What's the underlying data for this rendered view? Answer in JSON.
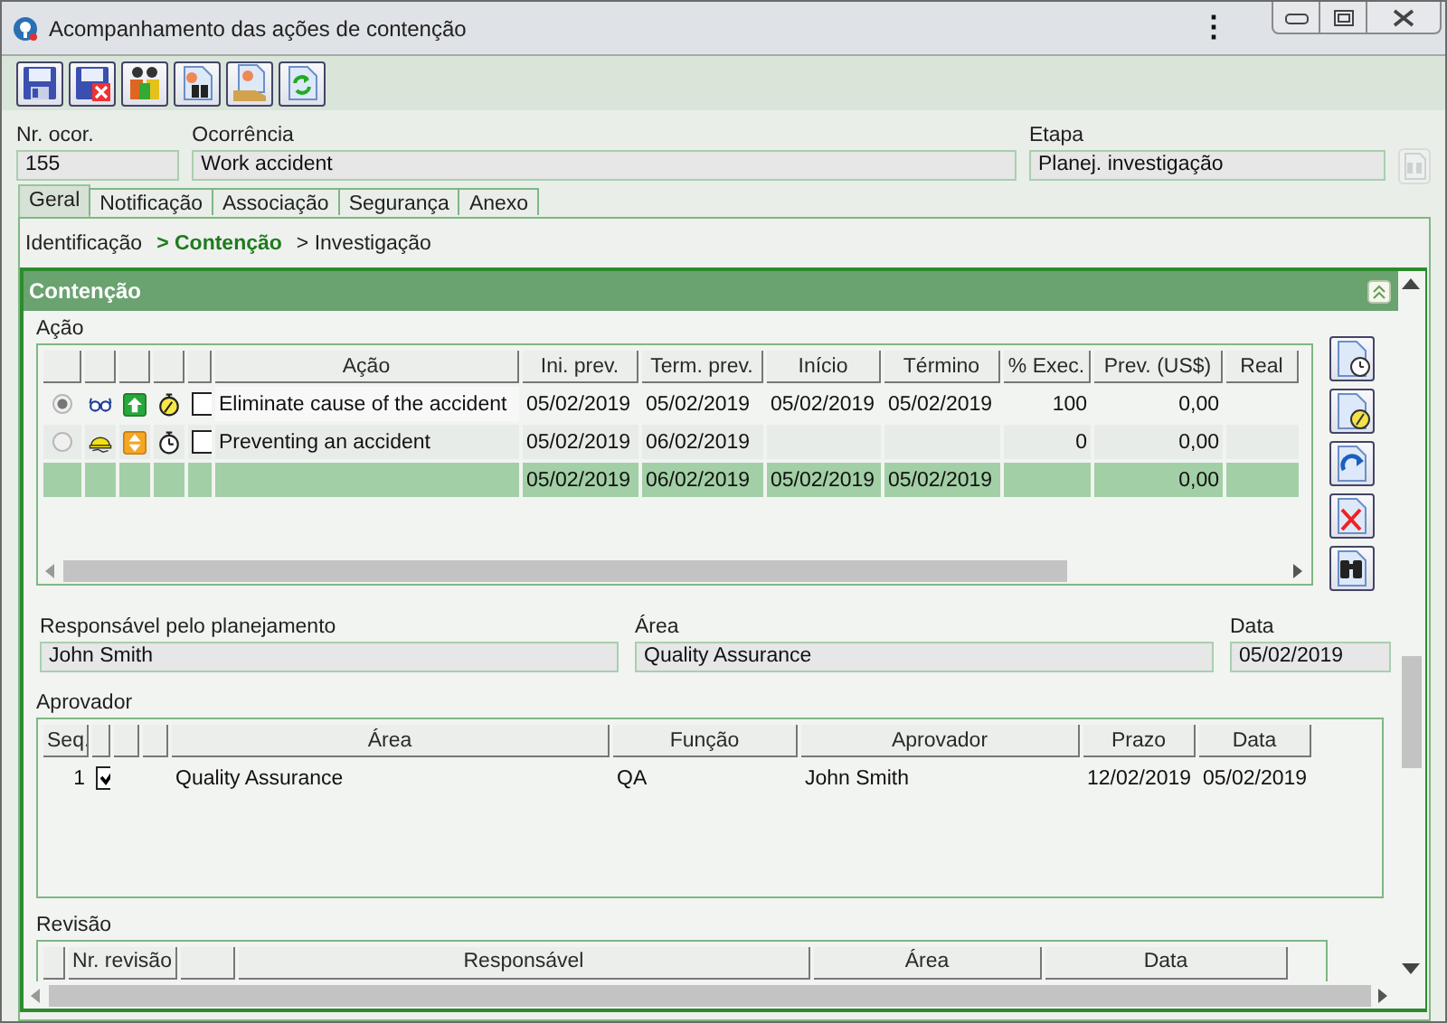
{
  "window": {
    "title": "Acompanhamento das ações de contenção",
    "menu_glyph": "⋮"
  },
  "header_fields": {
    "occurrence_number": {
      "label": "Nr. ocor.",
      "value": "155"
    },
    "occurrence": {
      "label": "Ocorrência",
      "value": "Work accident"
    },
    "stage": {
      "label": "Etapa",
      "value": "Planej. investigação",
      "lookup_disabled": true
    }
  },
  "tabs": [
    {
      "label": "Geral",
      "selected": true
    },
    {
      "label": "Notificação",
      "selected": false
    },
    {
      "label": "Associação",
      "selected": false
    },
    {
      "label": "Segurança",
      "selected": false
    },
    {
      "label": "Anexo",
      "selected": false
    }
  ],
  "steps": [
    {
      "label": "Identificação",
      "selected": false
    },
    {
      "label": "> Contenção",
      "selected": true
    },
    {
      "label": "> Investigação",
      "selected": false
    }
  ],
  "section": {
    "title": "Contenção",
    "expanded": true
  },
  "actions": {
    "label": "Ação",
    "columns": [
      {
        "kind": "radio"
      },
      {
        "kind": "category"
      },
      {
        "kind": "priority"
      },
      {
        "kind": "timer"
      },
      {
        "kind": "check"
      },
      {
        "kind": "text",
        "label": "Ação"
      },
      {
        "kind": "text",
        "label": "Ini. prev."
      },
      {
        "kind": "text",
        "label": "Term. prev."
      },
      {
        "kind": "text",
        "label": "Início"
      },
      {
        "kind": "text",
        "label": "Término"
      },
      {
        "kind": "text",
        "label": "% Exec."
      },
      {
        "kind": "text",
        "label": "Prev. (US$)"
      },
      {
        "kind": "text",
        "label": "Real"
      }
    ],
    "rows": [
      {
        "selected": true,
        "safety_category": false,
        "high_priority": true,
        "timer_alert": true,
        "checked": false,
        "cells": [
          "",
          "",
          "",
          "",
          "",
          "Eliminate cause of the accident",
          "05/02/2019",
          "05/02/2019",
          "05/02/2019",
          "05/02/2019",
          "100",
          "0,00",
          ""
        ]
      },
      {
        "selected": false,
        "safety_category": true,
        "high_priority": false,
        "timer_alert": false,
        "checked": false,
        "cells": [
          "",
          "",
          "",
          "",
          "",
          "Preventing an accident",
          "05/02/2019",
          "06/02/2019",
          "",
          "",
          "0",
          "0,00",
          ""
        ]
      }
    ],
    "total": {
      "cells": [
        "",
        "",
        "",
        "",
        "",
        "",
        "05/02/2019",
        "06/02/2019",
        "05/02/2019",
        "05/02/2019",
        "",
        "0,00",
        ""
      ]
    }
  },
  "planning": {
    "responsible": {
      "label": "Responsável pelo planejamento",
      "value": "John Smith"
    },
    "area": {
      "label": "Área",
      "value": "Quality Assurance"
    },
    "date": {
      "label": "Data",
      "value": "05/02/2019"
    }
  },
  "approvers": {
    "label": "Aprovador",
    "columns": [
      {
        "kind": "text",
        "label": "Seq."
      },
      {
        "kind": "check"
      },
      {
        "kind": "blank"
      },
      {
        "kind": "blank"
      },
      {
        "kind": "text",
        "label": "Área"
      },
      {
        "kind": "text",
        "label": "Função"
      },
      {
        "kind": "text",
        "label": "Aprovador"
      },
      {
        "kind": "text",
        "label": "Prazo"
      },
      {
        "kind": "text",
        "label": "Data"
      }
    ],
    "rows": [
      {
        "checked": true,
        "cells": [
          "1",
          "",
          "",
          "",
          "Quality Assurance",
          "QA",
          "John Smith",
          "12/02/2019",
          "05/02/2019"
        ]
      }
    ]
  },
  "revision": {
    "label": "Revisão",
    "columns": [
      null,
      "Nr. revisão",
      null,
      "Responsável",
      "Área",
      "Data"
    ]
  }
}
